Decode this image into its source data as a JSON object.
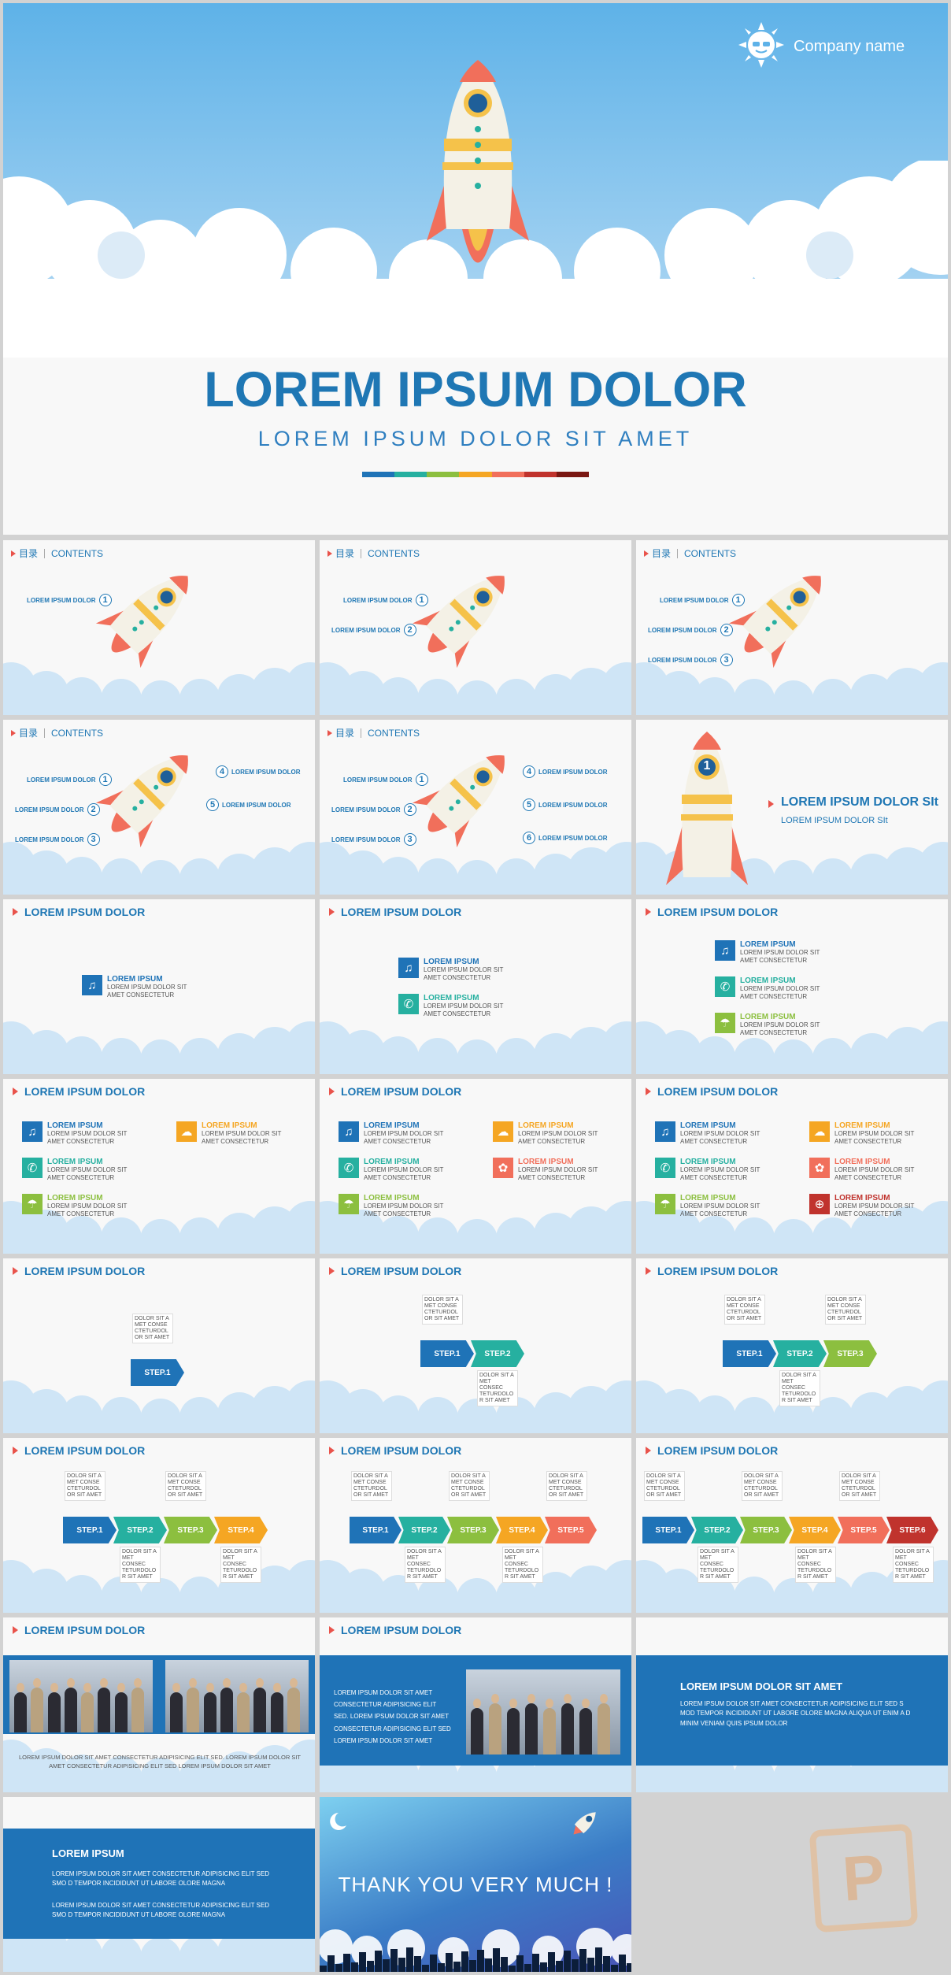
{
  "colors": {
    "blue": "#1f73b7",
    "teal": "#26b0a0",
    "green": "#8cbf3f",
    "yellow": "#f5a623",
    "orange": "#f16f5b",
    "red": "#c0332d"
  },
  "cover": {
    "company": "Company name",
    "title": "LOREM IPSUM DOLOR",
    "subtitle": "LOREM IPSUM DOLOR SIT AMET",
    "rainbow": [
      "#1f73b7",
      "#26b0a0",
      "#8cbf3f",
      "#f5a623",
      "#f16f5b",
      "#c0332d",
      "#7a1712"
    ]
  },
  "toc": {
    "cn": "目录",
    "en": "CONTENTS",
    "item": "LOREM IPSUM DOLOR",
    "item_short": "LOREM IPSUM DOLOR",
    "n1": "1",
    "n2": "2",
    "n3": "3",
    "n4": "4",
    "n5": "5",
    "n6": "6"
  },
  "section": {
    "num": "1",
    "title": "LOREM IPSUM DOLOR SIt",
    "sub": "LOREM IPSUM DOLOR SIt"
  },
  "slide_title": "LOREM IPSUM DOLOR",
  "icon_items": {
    "title": "LOREM IPSUM",
    "desc": "LOREM IPSUM DOLOR SIT AMET CONSECTETUR"
  },
  "steps": {
    "labels": [
      "STEP.1",
      "STEP.2",
      "STEP.3",
      "STEP.4",
      "STEP.5",
      "STEP.6"
    ],
    "note_top": "DOLOR SIT A MET CONSE CTETURDOL OR SIT AMET",
    "note_bottom": "DOLOR SIT A MET CONSEC TETURDOLO R SIT AMET"
  },
  "photo_slides": {
    "caption": "LOREM IPSUM DOLOR SIT AMET CONSECTETUR ADIPISICING ELIT SED. LOREM IPSUM DOLOR SIT AMET CONSECTETUR ADIPISICING ELIT SED LOREM IPSUM DOLOR SIT AMET",
    "side_text": "LOREM IPSUM DOLOR SIT AMET CONSECTETUR ADIPISICING ELIT SED. LOREM IPSUM DOLOR SIT AMET CONSECTETUR ADIPISICING ELIT SED LOREM IPSUM DOLOR SIT AMET",
    "band_title": "LOREM IPSUM DOLOR SIT AMET",
    "band_text": "LOREM IPSUM DOLOR SIT AMET CONSECTETUR ADIPISICING ELIT SED S MOD TEMPOR INCIDIDUNT UT LABORE OLORE MAGNA ALIQUA UT ENIM A D MINIM VENIAM QUIS IPSUM DOLOR"
  },
  "last": {
    "title": "LOREM IPSUM",
    "p1": "LOREM IPSUM DOLOR SIT AMET CONSECTETUR ADIPISICING ELIT SED SMO D TEMPOR INCIDIDUNT UT LABORE OLORE MAGNA",
    "p2": "LOREM IPSUM DOLOR SIT AMET CONSECTETUR ADIPISICING ELIT SED SMO D TEMPOR INCIDIDUNT UT LABORE OLORE MAGNA",
    "thanks": "THANK YOU VERY MUCH !"
  }
}
